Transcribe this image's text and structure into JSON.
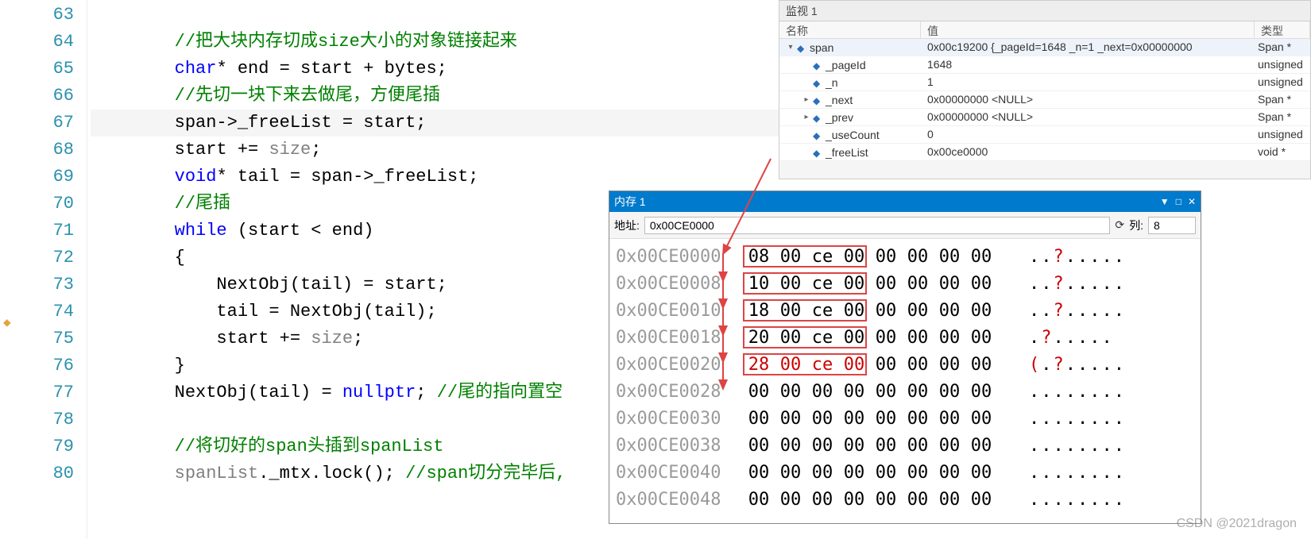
{
  "code": {
    "lines": [
      {
        "num": "63",
        "tokens": []
      },
      {
        "num": "64",
        "tokens": [
          {
            "cls": "c-comment",
            "indent": 2,
            "t": "//把大块内存切成size大小的对象链接起来"
          }
        ]
      },
      {
        "num": "65",
        "tokens": [
          {
            "cls": "c-keyword",
            "indent": 2,
            "t": "char"
          },
          {
            "cls": "c-normal",
            "t": "* end = start + bytes;"
          }
        ]
      },
      {
        "num": "66",
        "tokens": [
          {
            "cls": "c-comment",
            "indent": 2,
            "t": "//先切一块下来去做尾，方便尾插"
          }
        ]
      },
      {
        "num": "67",
        "hl": true,
        "tokens": [
          {
            "cls": "c-normal",
            "indent": 2,
            "t": "span->_freeList = start;"
          }
        ]
      },
      {
        "num": "68",
        "tokens": [
          {
            "cls": "c-normal",
            "indent": 2,
            "t": "start += "
          },
          {
            "cls": "c-dim",
            "t": "size"
          },
          {
            "cls": "c-normal",
            "t": ";"
          }
        ]
      },
      {
        "num": "69",
        "tokens": [
          {
            "cls": "c-keyword",
            "indent": 2,
            "t": "void"
          },
          {
            "cls": "c-normal",
            "t": "* tail = span->_freeList;"
          }
        ]
      },
      {
        "num": "70",
        "tokens": [
          {
            "cls": "c-comment",
            "indent": 2,
            "t": "//尾插"
          }
        ]
      },
      {
        "num": "71",
        "tokens": [
          {
            "cls": "c-keyword",
            "indent": 2,
            "t": "while"
          },
          {
            "cls": "c-normal",
            "t": " (start < end)"
          }
        ]
      },
      {
        "num": "72",
        "tokens": [
          {
            "cls": "c-normal",
            "indent": 2,
            "t": "{"
          }
        ]
      },
      {
        "num": "73",
        "tokens": [
          {
            "cls": "c-normal",
            "indent": 3,
            "t": "NextObj(tail) = start;"
          }
        ]
      },
      {
        "num": "74",
        "tokens": [
          {
            "cls": "c-normal",
            "indent": 3,
            "t": "tail = NextObj(tail);"
          }
        ]
      },
      {
        "num": "75",
        "tokens": [
          {
            "cls": "c-normal",
            "indent": 3,
            "t": "start += "
          },
          {
            "cls": "c-dim",
            "t": "size"
          },
          {
            "cls": "c-normal",
            "t": ";"
          }
        ]
      },
      {
        "num": "76",
        "tokens": [
          {
            "cls": "c-normal",
            "indent": 2,
            "t": "}"
          }
        ]
      },
      {
        "num": "77",
        "tokens": [
          {
            "cls": "c-normal",
            "indent": 2,
            "t": "NextObj(tail) = "
          },
          {
            "cls": "c-keyword",
            "t": "nullptr"
          },
          {
            "cls": "c-normal",
            "t": "; "
          },
          {
            "cls": "c-comment",
            "t": "//尾的指向置空"
          }
        ]
      },
      {
        "num": "78",
        "tokens": []
      },
      {
        "num": "79",
        "tokens": [
          {
            "cls": "c-comment",
            "indent": 2,
            "t": "//将切好的span头插到spanList"
          }
        ]
      },
      {
        "num": "80",
        "tokens": [
          {
            "cls": "c-dim",
            "indent": 2,
            "t": "spanList"
          },
          {
            "cls": "c-normal",
            "t": "._mtx.lock(); "
          },
          {
            "cls": "c-comment",
            "t": "//span切分完毕后,"
          }
        ]
      }
    ]
  },
  "watch": {
    "title": "监视 1",
    "headers": {
      "name": "名称",
      "value": "值",
      "type": "类型"
    },
    "rows": [
      {
        "level": 0,
        "exp": "down",
        "icon": true,
        "name": "span",
        "value": "0x00c19200 {_pageId=1648 _n=1 _next=0x00000000",
        "type": "Span *",
        "sel": true
      },
      {
        "level": 1,
        "exp": "",
        "icon": true,
        "name": "_pageId",
        "value": "1648",
        "type": "unsigned"
      },
      {
        "level": 1,
        "exp": "",
        "icon": true,
        "name": "_n",
        "value": "1",
        "type": "unsigned"
      },
      {
        "level": 1,
        "exp": "right",
        "icon": true,
        "name": "_next",
        "value": "0x00000000 <NULL>",
        "type": "Span *"
      },
      {
        "level": 1,
        "exp": "right",
        "icon": true,
        "name": "_prev",
        "value": "0x00000000 <NULL>",
        "type": "Span *"
      },
      {
        "level": 1,
        "exp": "",
        "icon": true,
        "name": "_useCount",
        "value": "0",
        "type": "unsigned"
      },
      {
        "level": 1,
        "exp": "",
        "icon": true,
        "name": "_freeList",
        "value": "0x00ce0000",
        "type": "void *"
      }
    ]
  },
  "memory": {
    "title": "内存 1",
    "addr_label": "地址:",
    "addr_value": "0x00CE0000",
    "col_label": "列:",
    "col_value": "8",
    "rows": [
      {
        "addr": "0x00CE0000",
        "box": true,
        "hex": [
          {
            "t": "08"
          },
          {
            "t": "00"
          },
          {
            "t": "ce"
          },
          {
            "t": "00"
          },
          {
            "t": "00"
          },
          {
            "t": "00"
          },
          {
            "t": "00"
          },
          {
            "t": "00"
          }
        ],
        "ascii": [
          {
            "t": ".."
          },
          {
            "t": "?",
            "r": true
          },
          {
            "t": "....."
          }
        ]
      },
      {
        "addr": "0x00CE0008",
        "box": true,
        "hex": [
          {
            "t": "10"
          },
          {
            "t": "00"
          },
          {
            "t": "ce"
          },
          {
            "t": "00"
          },
          {
            "t": "00"
          },
          {
            "t": "00"
          },
          {
            "t": "00"
          },
          {
            "t": "00"
          }
        ],
        "ascii": [
          {
            "t": ".."
          },
          {
            "t": "?",
            "r": true
          },
          {
            "t": "....."
          }
        ]
      },
      {
        "addr": "0x00CE0010",
        "box": true,
        "hex": [
          {
            "t": "18"
          },
          {
            "t": "00"
          },
          {
            "t": "ce"
          },
          {
            "t": "00"
          },
          {
            "t": "00"
          },
          {
            "t": "00"
          },
          {
            "t": "00"
          },
          {
            "t": "00"
          }
        ],
        "ascii": [
          {
            "t": ".."
          },
          {
            "t": "?",
            "r": true
          },
          {
            "t": "....."
          }
        ]
      },
      {
        "addr": "0x00CE0018",
        "box": true,
        "hex": [
          {
            "t": "20"
          },
          {
            "t": "00"
          },
          {
            "t": "ce"
          },
          {
            "t": "00"
          },
          {
            "t": "00"
          },
          {
            "t": "00"
          },
          {
            "t": "00"
          },
          {
            "t": "00"
          }
        ],
        "ascii": [
          {
            "t": " ."
          },
          {
            "t": "?",
            "r": true
          },
          {
            "t": "....."
          }
        ]
      },
      {
        "addr": "0x00CE0020",
        "box": true,
        "red": [
          0,
          1,
          2,
          3
        ],
        "hex": [
          {
            "t": "28",
            "r": true
          },
          {
            "t": "00",
            "r": true
          },
          {
            "t": "ce",
            "r": true
          },
          {
            "t": "00",
            "r": true
          },
          {
            "t": "00"
          },
          {
            "t": "00"
          },
          {
            "t": "00"
          },
          {
            "t": "00"
          }
        ],
        "ascii": [
          {
            "t": "(",
            "r": true
          },
          {
            "t": "."
          },
          {
            "t": "?",
            "r": true
          },
          {
            "t": "....."
          }
        ]
      },
      {
        "addr": "0x00CE0028",
        "hex": [
          {
            "t": "00"
          },
          {
            "t": "00"
          },
          {
            "t": "00"
          },
          {
            "t": "00"
          },
          {
            "t": "00"
          },
          {
            "t": "00"
          },
          {
            "t": "00"
          },
          {
            "t": "00"
          }
        ],
        "ascii": [
          {
            "t": "........"
          }
        ]
      },
      {
        "addr": "0x00CE0030",
        "hex": [
          {
            "t": "00"
          },
          {
            "t": "00"
          },
          {
            "t": "00"
          },
          {
            "t": "00"
          },
          {
            "t": "00"
          },
          {
            "t": "00"
          },
          {
            "t": "00"
          },
          {
            "t": "00"
          }
        ],
        "ascii": [
          {
            "t": "........"
          }
        ]
      },
      {
        "addr": "0x00CE0038",
        "hex": [
          {
            "t": "00"
          },
          {
            "t": "00"
          },
          {
            "t": "00"
          },
          {
            "t": "00"
          },
          {
            "t": "00"
          },
          {
            "t": "00"
          },
          {
            "t": "00"
          },
          {
            "t": "00"
          }
        ],
        "ascii": [
          {
            "t": "........"
          }
        ]
      },
      {
        "addr": "0x00CE0040",
        "hex": [
          {
            "t": "00"
          },
          {
            "t": "00"
          },
          {
            "t": "00"
          },
          {
            "t": "00"
          },
          {
            "t": "00"
          },
          {
            "t": "00"
          },
          {
            "t": "00"
          },
          {
            "t": "00"
          }
        ],
        "ascii": [
          {
            "t": "........"
          }
        ]
      },
      {
        "addr": "0x00CE0048",
        "hex": [
          {
            "t": "00"
          },
          {
            "t": "00"
          },
          {
            "t": "00"
          },
          {
            "t": "00"
          },
          {
            "t": "00"
          },
          {
            "t": "00"
          },
          {
            "t": "00"
          },
          {
            "t": "00"
          }
        ],
        "ascii": [
          {
            "t": "........"
          }
        ]
      }
    ]
  },
  "watermark": "CSDN @2021dragon"
}
